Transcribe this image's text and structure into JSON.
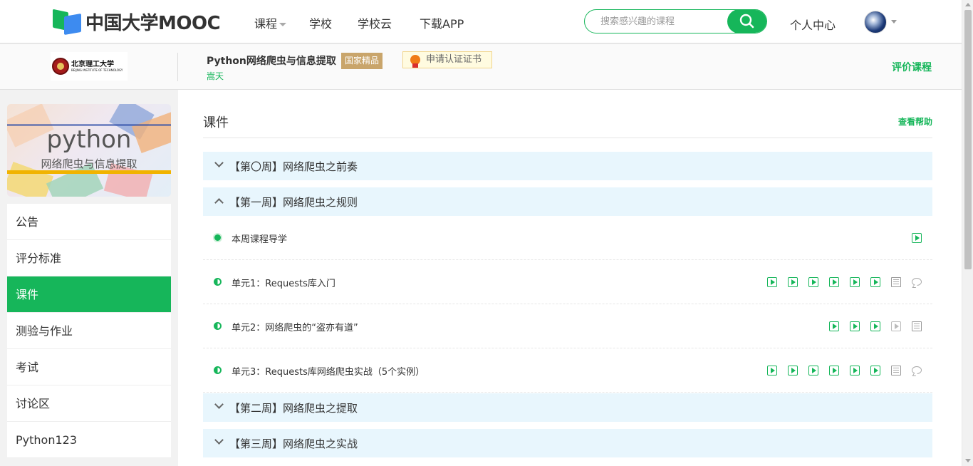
{
  "header": {
    "logo_text": "中国大学MOOC",
    "nav": [
      {
        "label": "课程",
        "has_caret": true
      },
      {
        "label": "学校"
      },
      {
        "label": "学校云"
      },
      {
        "label": "下载APP"
      }
    ],
    "search": {
      "placeholder": "搜索感兴趣的课程",
      "value": ""
    },
    "user_center": "个人中心"
  },
  "course": {
    "school_name": "北京理工大学",
    "school_name_en": "BEIJING INSTITUTE OF TECHNOLOGY",
    "title": "Python网络爬虫与信息提取",
    "badge": "国家精品",
    "cert_label": "申请认证证书",
    "teacher": "嵩天",
    "rate_label": "评价课程"
  },
  "sidebar": {
    "cover_title": "python",
    "cover_subtitle": "网络爬虫与信息提取",
    "items": [
      {
        "label": "公告",
        "active": false
      },
      {
        "label": "评分标准",
        "active": false
      },
      {
        "label": "课件",
        "active": true
      },
      {
        "label": "测验与作业",
        "active": false
      },
      {
        "label": "考试",
        "active": false
      },
      {
        "label": "讨论区",
        "active": false
      },
      {
        "label": "Python123",
        "active": false
      }
    ]
  },
  "main": {
    "title": "课件",
    "help_label": "查看帮助",
    "chapters": [
      {
        "label": "【第〇周】网络爬虫之前奏",
        "expanded": false
      },
      {
        "label": "【第一周】网络爬虫之规则",
        "expanded": true,
        "lessons": [
          {
            "label": "本周课程导学",
            "progress": "full",
            "icons": [
              "video-icon"
            ]
          },
          {
            "label": "单元1：Requests库入门",
            "progress": "half",
            "icons": [
              "video-icon",
              "video-icon",
              "video-icon",
              "video-icon",
              "video-icon",
              "video-icon",
              "document-icon",
              "discussion-icon"
            ]
          },
          {
            "label": "单元2：网络爬虫的“盗亦有道”",
            "progress": "half",
            "icons": [
              "video-icon",
              "video-icon",
              "video-icon",
              "video-grey-icon",
              "document-icon"
            ]
          },
          {
            "label": "单元3：Requests库网络爬虫实战（5个实例）",
            "progress": "half",
            "icons": [
              "video-icon",
              "video-icon",
              "video-icon",
              "video-icon",
              "video-icon",
              "video-icon",
              "document-icon",
              "discussion-icon"
            ]
          }
        ]
      },
      {
        "label": "【第二周】网络爬虫之提取",
        "expanded": false
      },
      {
        "label": "【第三周】网络爬虫之实战",
        "expanded": false
      }
    ]
  },
  "colors": {
    "accent": "#16b65a",
    "chapter_bg": "#e8f6fd",
    "badge": "#c9a56b"
  }
}
